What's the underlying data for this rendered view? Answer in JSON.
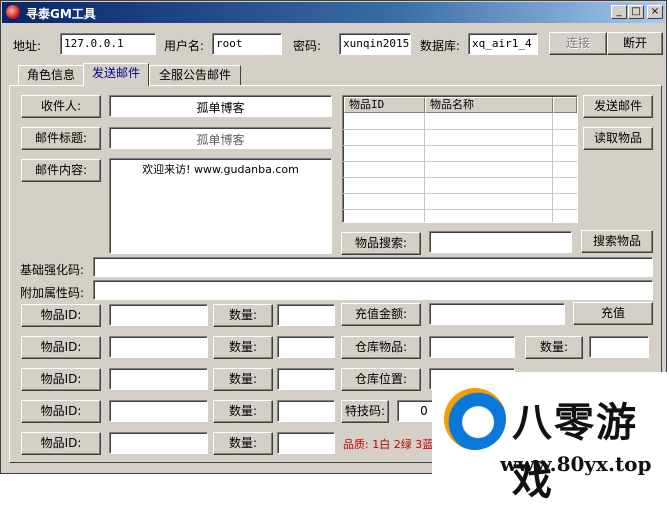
{
  "window": {
    "title": "寻泰GM工具",
    "minimize": "_",
    "maximize": "□",
    "close": "×"
  },
  "connection": {
    "address_label": "地址:",
    "address_value": "127.0.0.1",
    "user_label": "用户名:",
    "user_value": "root",
    "password_label": "密码:",
    "password_value": "xunqin2015",
    "db_label": "数据库:",
    "db_value": "xq_air1_4",
    "connect_button": "连接",
    "disconnect_button": "断开"
  },
  "tabs": [
    {
      "label": "角色信息",
      "active": false
    },
    {
      "label": "发送邮件",
      "active": true
    },
    {
      "label": "全服公告邮件",
      "active": false
    }
  ],
  "mail": {
    "recipient_button": "收件人:",
    "recipient_value": "孤单博客",
    "subject_button": "邮件标题:",
    "subject_value": "孤单博客",
    "content_button": "邮件内容:",
    "content_value": "欢迎来访! www.gudanba.com"
  },
  "item_grid": {
    "headers": [
      "物品ID",
      "物品名称"
    ]
  },
  "actions": {
    "send_mail": "发送邮件",
    "read_items": "读取物品",
    "item_search_label": "物品搜索:",
    "item_search_value": "",
    "search_items": "搜索物品"
  },
  "codes": {
    "base_label": "基础强化码:",
    "base_value": "",
    "extra_label": "附加属性码:",
    "extra_value": ""
  },
  "item_rows": [
    {
      "id_label": "物品ID:",
      "qty_label": "数量:"
    },
    {
      "id_label": "物品ID:",
      "qty_label": "数量:"
    },
    {
      "id_label": "物品ID:",
      "qty_label": "数量:"
    },
    {
      "id_label": "物品ID:",
      "qty_label": "数量:"
    },
    {
      "id_label": "物品ID:",
      "qty_label": "数量:"
    }
  ],
  "recharge": {
    "amount_label": "充值金额:",
    "amount_value": "",
    "button": "充值"
  },
  "warehouse": {
    "item_label": "仓库物品:",
    "qty_label": "数量:",
    "position_label": "仓库位置:"
  },
  "skill": {
    "label": "特技码:",
    "value": "0"
  },
  "quality_text": "品质: 1白 2绿 3蓝",
  "watermark": {
    "text": "八零游戏",
    "url": "www.80yx.top"
  }
}
